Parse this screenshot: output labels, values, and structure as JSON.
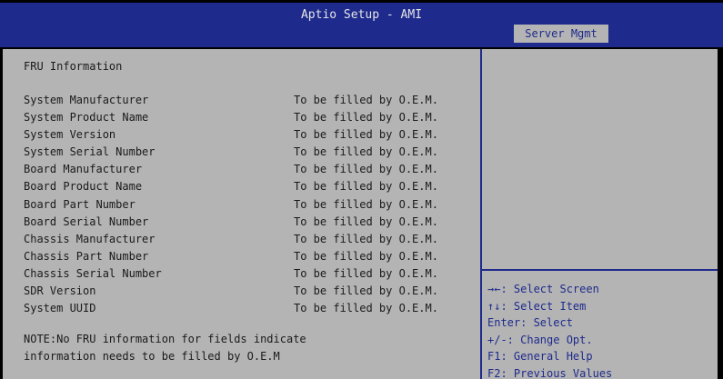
{
  "app": {
    "title": "Aptio Setup - AMI",
    "active_tab": "Server Mgmt"
  },
  "colors": {
    "header_bg": "#1e2a8c",
    "panel_bg": "#b4b4b4",
    "text": "#1a1a1a",
    "help_text": "#1e2a8c"
  },
  "main": {
    "section_title": "FRU Information",
    "rows": [
      {
        "label": "System Manufacturer",
        "value": "To be filled by O.E.M."
      },
      {
        "label": "System Product Name",
        "value": "To be filled by O.E.M."
      },
      {
        "label": "System Version",
        "value": "To be filled by O.E.M."
      },
      {
        "label": "System Serial Number",
        "value": "To be filled by O.E.M."
      },
      {
        "label": "Board Manufacturer",
        "value": "To be filled by O.E.M."
      },
      {
        "label": "Board Product Name",
        "value": "To be filled by O.E.M."
      },
      {
        "label": "Board Part Number",
        "value": "To be filled by O.E.M."
      },
      {
        "label": "Board Serial Number",
        "value": "To be filled by O.E.M."
      },
      {
        "label": "Chassis Manufacturer",
        "value": "To be filled by O.E.M."
      },
      {
        "label": "Chassis Part Number",
        "value": "To be filled by O.E.M."
      },
      {
        "label": "Chassis Serial Number",
        "value": "To be filled by O.E.M."
      },
      {
        "label": "SDR Version",
        "value": "To be filled by O.E.M."
      },
      {
        "label": "System UUID",
        "value": "To be filled by O.E.M."
      }
    ],
    "note_line1": "NOTE:No FRU information for fields indicate",
    "note_line2": "information needs to be filled by O.E.M"
  },
  "help": {
    "items": [
      "→←: Select Screen",
      "↑↓: Select Item",
      "Enter: Select",
      "+/-: Change Opt.",
      "F1: General Help",
      "F2: Previous Values"
    ]
  }
}
